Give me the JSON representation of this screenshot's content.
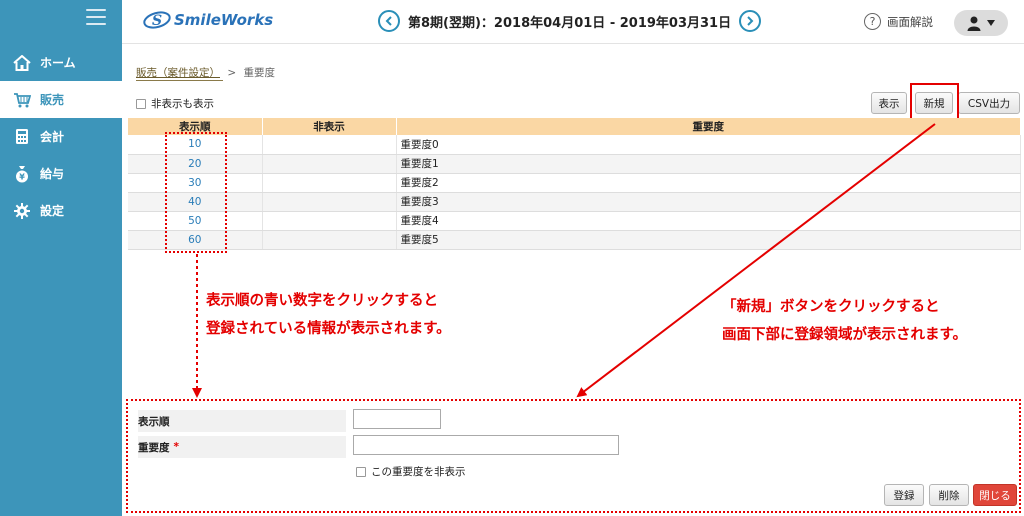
{
  "app": {
    "logo_text": "SmileWorks"
  },
  "sidebar": {
    "items": [
      {
        "label": "ホーム",
        "icon": "home-icon"
      },
      {
        "label": "販売",
        "icon": "cart-icon",
        "active": true
      },
      {
        "label": "会計",
        "icon": "calculator-icon"
      },
      {
        "label": "給与",
        "icon": "money-bag-icon"
      },
      {
        "label": "設定",
        "icon": "gear-icon"
      }
    ]
  },
  "header": {
    "period": "第8期(翌期)：2018年04月01日 - 2019年03月31日",
    "help_label": "画面解説"
  },
  "breadcrumb": {
    "parent": "販売（案件設定）",
    "separator": ">",
    "current": "重要度"
  },
  "filter": {
    "show_hidden_label": "非表示も表示"
  },
  "toolbar": {
    "show_label": "表示",
    "new_label": "新規",
    "csv_label": "CSV出力"
  },
  "table": {
    "headers": [
      "表示順",
      "非表示",
      "重要度"
    ],
    "rows": [
      {
        "order": "10",
        "hidden": "",
        "name": "重要度0"
      },
      {
        "order": "20",
        "hidden": "",
        "name": "重要度1"
      },
      {
        "order": "30",
        "hidden": "",
        "name": "重要度2"
      },
      {
        "order": "40",
        "hidden": "",
        "name": "重要度3"
      },
      {
        "order": "50",
        "hidden": "",
        "name": "重要度4"
      },
      {
        "order": "60",
        "hidden": "",
        "name": "重要度5"
      }
    ]
  },
  "annotations": {
    "left_line1": "表示順の青い数字をクリックすると",
    "left_line2": "登録されている情報が表示されます。",
    "right_line1": "「新規」ボタンをクリックすると",
    "right_line2": "画面下部に登録領域が表示されます。",
    "accent_color": "#e40000"
  },
  "form": {
    "order_label": "表示順",
    "order_value": "",
    "name_label": "重要度",
    "required_mark": "*",
    "name_value": "",
    "hide_label": "この重要度を非表示",
    "register_label": "登録",
    "delete_label": "削除",
    "close_label": "閉じる"
  },
  "colors": {
    "sidebar": "#3d95ba",
    "table_header": "#fad7a4",
    "close_button": "#e0463a"
  }
}
